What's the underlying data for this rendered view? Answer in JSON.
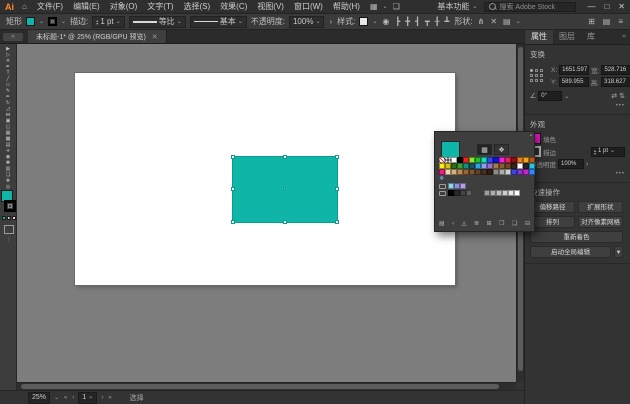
{
  "colors": {
    "teal": "#0fb5a6",
    "magenta": "#f214c8",
    "artboard": "#ffffff",
    "pasteboard": "#7d7d7d"
  },
  "icons": {
    "home": "⌂",
    "caret": "⌄",
    "caret_right": "›",
    "minimize": "—",
    "restore": "□",
    "close": "✕",
    "arrange_docs": "▦",
    "share": "❏",
    "grid": "⊞",
    "rows": "▤",
    "menu": "≡",
    "angle": "∠",
    "flip_h": "⇄",
    "flip_v": "⇅",
    "link_off": "⊘",
    "more": "•••",
    "stepper_up": "▴",
    "stepper_down": "▾",
    "first": "«",
    "prev": "‹",
    "next": "›",
    "last": "»",
    "recolor": "◉",
    "isolate": "✕",
    "shape_widget": "⋔",
    "collapse": "«",
    "dots_v": "⋮",
    "panel_collapse": "▪"
  },
  "menu_bar": {
    "logo": "Ai",
    "items": [
      "文件(F)",
      "编辑(E)",
      "对象(O)",
      "文字(T)",
      "选择(S)",
      "效果(C)",
      "视图(V)",
      "窗口(W)",
      "帮助(H)"
    ],
    "workspace_label": "基本功能",
    "search_label": "搜索 Adobe Stock"
  },
  "control_bar": {
    "tool_label": "矩形",
    "stroke_label": "描边:",
    "stroke_weight": "1 pt",
    "profile_label": "等比",
    "brush_label": "基本",
    "opacity_label": "不透明度:",
    "opacity_value": "100%",
    "style_label": "样式:",
    "shape_label": "形状:",
    "align_icons": [
      {
        "n": "align-left-icon",
        "g": "┣"
      },
      {
        "n": "align-center-h-icon",
        "g": "╋"
      },
      {
        "n": "align-right-icon",
        "g": "┫"
      },
      {
        "n": "align-top-icon",
        "g": "┳"
      },
      {
        "n": "align-center-v-icon",
        "g": "╂"
      },
      {
        "n": "align-bottom-icon",
        "g": "┻"
      }
    ]
  },
  "doc_tab": {
    "title": "未标题-1* @ 25% (RGB/GPU 预览)",
    "close": "✕"
  },
  "tools": [
    {
      "n": "selection-tool",
      "g": "▶"
    },
    {
      "n": "direct-selection-tool",
      "g": "▷"
    },
    {
      "n": "magic-wand-tool",
      "g": "✳"
    },
    {
      "n": "pen-tool",
      "g": "✒"
    },
    {
      "n": "type-tool",
      "g": "T"
    },
    {
      "n": "line-segment-tool",
      "g": "╱"
    },
    {
      "n": "rectangle-tool",
      "g": "▭"
    },
    {
      "n": "paintbrush-tool",
      "g": "✎"
    },
    {
      "n": "pencil-tool",
      "g": "✏"
    },
    {
      "n": "rotate-tool",
      "g": "↻"
    },
    {
      "n": "scale-tool",
      "g": "◿"
    },
    {
      "n": "width-tool",
      "g": "⋈"
    },
    {
      "n": "free-transform-tool",
      "g": "▣"
    },
    {
      "n": "shape-builder-tool",
      "g": "◱"
    },
    {
      "n": "perspective-grid-tool",
      "g": "▦"
    },
    {
      "n": "mesh-tool",
      "g": "▩"
    },
    {
      "n": "gradient-tool",
      "g": "▤"
    },
    {
      "n": "eyedropper-tool",
      "g": "✛"
    },
    {
      "n": "blend-tool",
      "g": "◉"
    },
    {
      "n": "symbol-sprayer-tool",
      "g": "✽"
    },
    {
      "n": "column-graph-tool",
      "g": "▥"
    },
    {
      "n": "artboard-tool",
      "g": "❏"
    },
    {
      "n": "hand-tool",
      "g": "✥"
    },
    {
      "n": "zoom-tool",
      "g": "◎"
    }
  ],
  "swatches_panel": {
    "row1": [
      "none",
      "reg",
      "#ffffff",
      "#000000",
      "#f8201f",
      "#8ce62c",
      "#20c228",
      "#12e2b4",
      "#2a4ef2",
      "#1212e6",
      "#ee22e6",
      "#ea2159",
      "#8e1117",
      "#ec7d1f",
      "#f2a41f",
      "#bb5a14"
    ],
    "row2": [
      "#f6ec16",
      "#d8c20e",
      "#2c6e1e",
      "#36a42c",
      "#139084",
      "#1a5066",
      "#2aa8e2",
      "#8aa0f0",
      "#9a70d0",
      "#a87a40",
      "#8a6030",
      "#6e4a24",
      "#3a2514",
      "#ffffff",
      "#262626",
      "#22c8e8"
    ],
    "row3": [
      "#f01a8c",
      "#ead9b0",
      "#d4b183",
      "#b98a55",
      "#96653a",
      "#7a5433",
      "#5e4126",
      "#46311c",
      "#2f2013",
      "#8c8c8c",
      "#aeaeae",
      "#d0d0d0",
      "#3a4ae0",
      "#8a35cc",
      "#cc24cc",
      "#2a8aff"
    ],
    "group1": [
      "#8fd4e8",
      "#9090da",
      "#b8a0e0"
    ],
    "group2": [
      "#000000",
      "#2b2b2b",
      "#454545",
      "#5e5e5e",
      "",
      "",
      "#9e9e9e",
      "#aeaeae",
      "#bebebe",
      "#cecece",
      "#e6e6e6",
      "#ffffff"
    ],
    "tabs": [
      {
        "n": "swatches-tab-icon",
        "g": "▦"
      },
      {
        "n": "color-mixer-tab-icon",
        "g": "❖"
      }
    ],
    "kind_icon": "❖",
    "footer_icons": [
      {
        "n": "swatch-libraries-icon",
        "g": "▤"
      },
      {
        "n": "show-swatch-kinds-icon",
        "g": "‹"
      },
      {
        "n": "color-themes-icon",
        "g": "◬"
      },
      {
        "n": "swatch-options-icon",
        "g": "≣"
      },
      {
        "n": "new-color-group-icon",
        "g": "⊞"
      },
      {
        "n": "open-library-icon",
        "g": "❒"
      },
      {
        "n": "new-swatch-icon",
        "g": "❏"
      },
      {
        "n": "delete-swatch-icon",
        "g": "⊟"
      }
    ]
  },
  "properties": {
    "tabs": [
      "属性",
      "图层",
      "库"
    ],
    "transform": {
      "header": "变换",
      "x_label": "X:",
      "x": "1651.597",
      "y_label": "Y:",
      "y": "589.955",
      "w_label": "宽:",
      "w": "528.716",
      "h_label": "高:",
      "h": "318.627",
      "angle": "0°"
    },
    "appearance": {
      "header": "外观",
      "fill_label": "填色",
      "stroke_label": "描边",
      "stroke_weight": "1 pt",
      "opacity_label": "不透明度",
      "opacity_value": "100%"
    },
    "quick_actions": {
      "header": "快速操作",
      "buttons": [
        "偏移路径",
        "扩展形状",
        "排列",
        "对齐像素网格",
        "重新着色",
        "启动全局编辑"
      ]
    }
  },
  "status_bar": {
    "zoom": "25%",
    "artboard": "1",
    "status": "选择"
  }
}
